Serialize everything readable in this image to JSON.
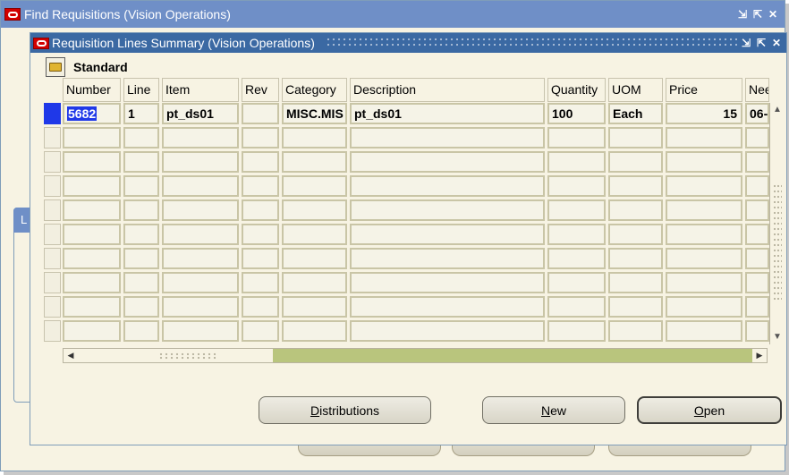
{
  "outer_window": {
    "title": "Find Requisitions (Vision Operations)"
  },
  "background_panel": {
    "tab_label": "L"
  },
  "inner_window": {
    "title": "Requisition Lines Summary (Vision Operations)",
    "folder": {
      "icon": "open-folder-icon",
      "name": "Standard"
    }
  },
  "table": {
    "columns": [
      "Number",
      "Line",
      "Item",
      "Rev",
      "Category",
      "Description",
      "Quantity",
      "UOM",
      "Price",
      "Nee"
    ],
    "rows": [
      {
        "number": "5682",
        "line": "1",
        "item": "pt_ds01",
        "rev": "",
        "category": "MISC.MIS",
        "description": "pt_ds01",
        "quantity": "100",
        "uom": "Each",
        "price": "15",
        "need_by": "06-"
      }
    ]
  },
  "buttons": {
    "distributions": {
      "mnemonic": "D",
      "rest": "istributions"
    },
    "new": {
      "mnemonic": "N",
      "rest": "ew"
    },
    "open": {
      "mnemonic": "O",
      "rest": "pen"
    }
  },
  "colors": {
    "title_active": "#3b69a3",
    "title_inactive": "#6f8fc7",
    "selection": "#1f38e8",
    "background": "#f7f3e3"
  }
}
